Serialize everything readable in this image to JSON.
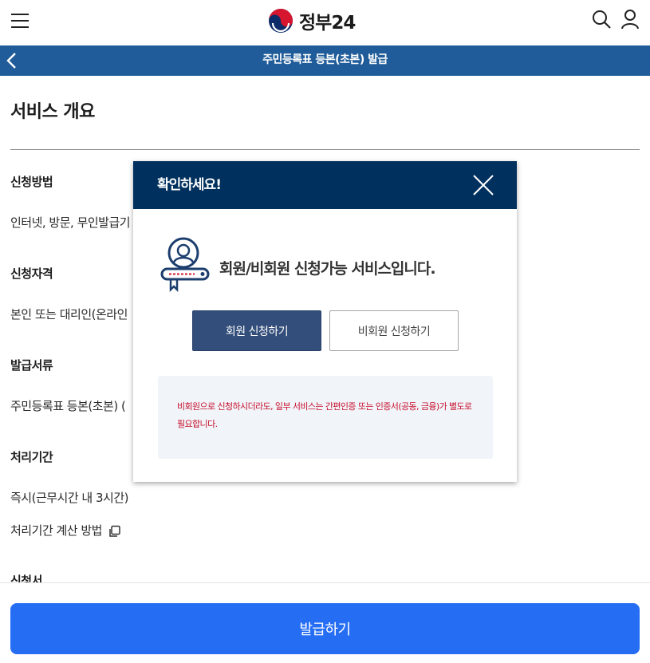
{
  "header": {
    "logo_text": "정부24",
    "menu_icon": "hamburger-menu-icon",
    "search_icon": "search-icon",
    "user_icon": "user-icon"
  },
  "subbar": {
    "title": "주민등록표 등본(초본) 발급",
    "back_icon": "chevron-left-icon"
  },
  "overview": {
    "title": "서비스 개요",
    "items": [
      {
        "label": "신청방법",
        "value": "인터넷, 방문, 무인발급기"
      },
      {
        "label": "신청자격",
        "value": "본인 또는 대리인(온라인"
      },
      {
        "label": "발급서류",
        "value": "주민등록표 등본(초본) ("
      },
      {
        "label": "처리기간",
        "value": "즉시(근무시간 내 3시간)",
        "extra": "처리기간 계산 방법"
      },
      {
        "label": "신청서"
      }
    ]
  },
  "modal": {
    "title": "확인하세요!",
    "message": "회원/비회원 신청가능 서비스입니다.",
    "member_button": "회원 신청하기",
    "nonmember_button": "비회원 신청하기",
    "notice": "비회원으로 신청하시더라도, 일부 서비스는 간편인증 또는 인증서(공동, 금융)가 별도로 필요합니다.",
    "close_icon": "close-icon",
    "illustration_icon": "user-certificate-icon"
  },
  "bottom": {
    "issue_button": "발급하기"
  },
  "colors": {
    "subbar_bg": "#1f5c99",
    "modal_header_bg": "#00305e",
    "member_button_bg": "#334e7a",
    "issue_button_bg": "#256ef4",
    "notice_text": "#c8102e"
  }
}
